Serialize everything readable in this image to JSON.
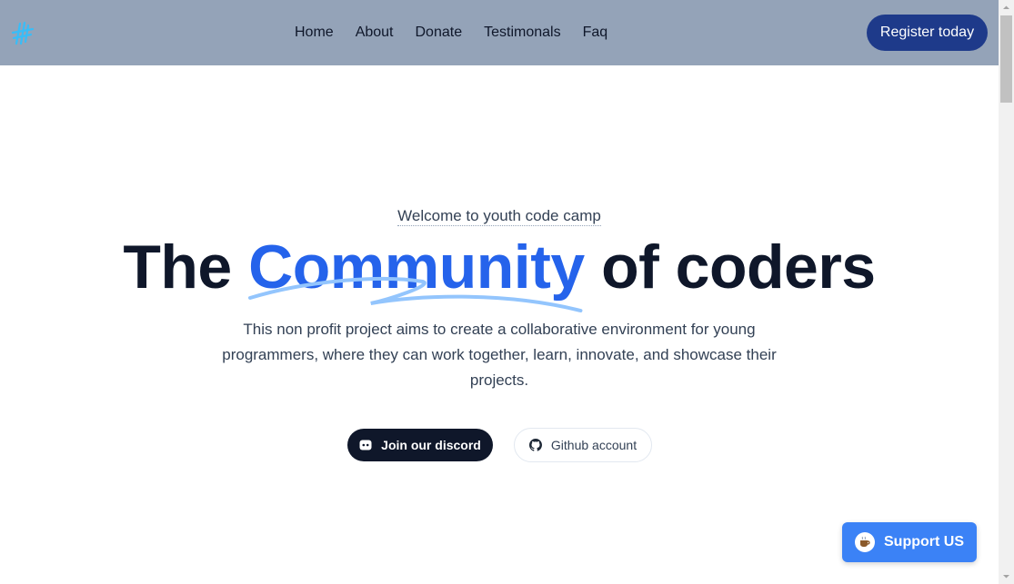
{
  "header": {
    "nav": [
      "Home",
      "About",
      "Donate",
      "Testimonals",
      "Faq"
    ],
    "register_label": "Register today"
  },
  "hero": {
    "welcome": "Welcome to youth code camp",
    "headline_before": "The",
    "headline_accent": "Community",
    "headline_after": "of coders",
    "description": "This non profit project aims to create a collaborative environment for young programmers, where they can work together, learn, innovate, and showcase their projects.",
    "discord_label": "Join our discord",
    "github_label": "Github account"
  },
  "support": {
    "label": "Support US"
  },
  "icons": {
    "logo": "logo-icon",
    "discord": "discord-icon",
    "github": "github-icon",
    "coffee": "coffee-icon"
  },
  "colors": {
    "header_bg": "#94a3b8",
    "accent": "#2563eb",
    "register_bg": "#1e3a8a",
    "dark": "#0f172a",
    "support_bg": "#3b82f6",
    "squiggle": "#93c5fd"
  }
}
